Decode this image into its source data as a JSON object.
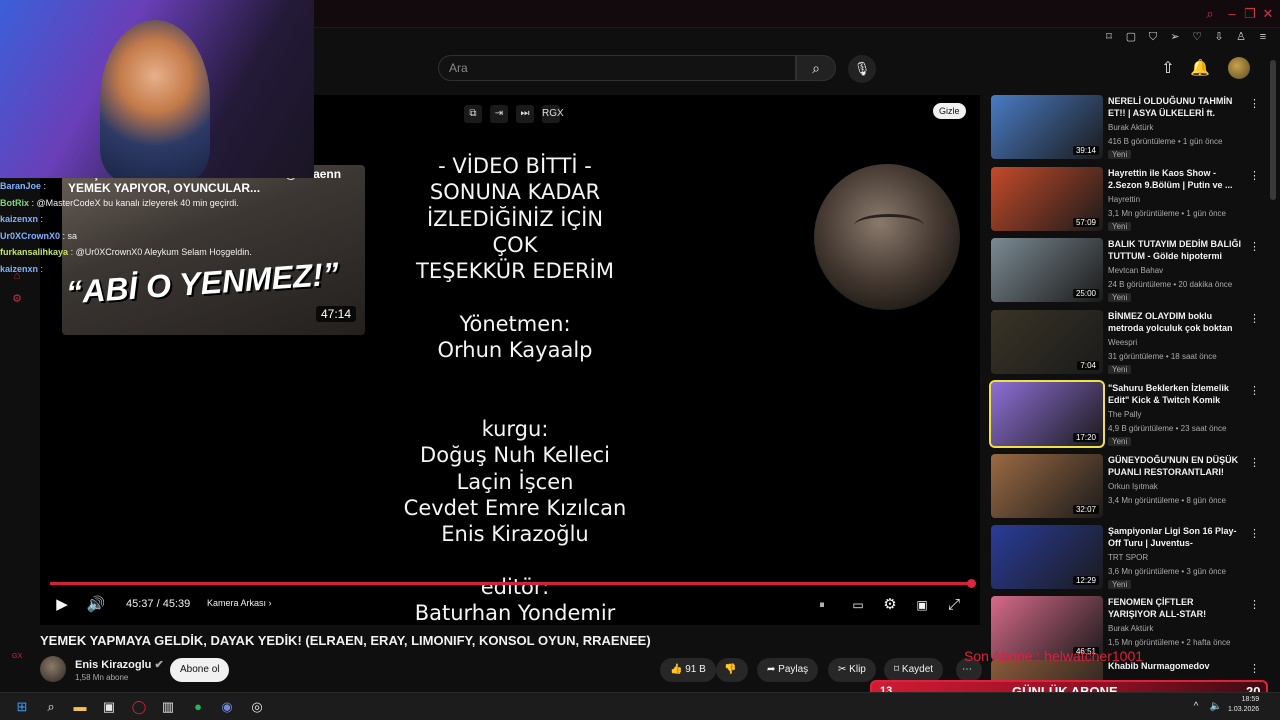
{
  "header": {
    "search_placeholder": "Ara",
    "search_icon": "search-icon",
    "mic_icon": "mic-icon",
    "upload_icon": "upload-icon",
    "bell_icon": "bell-icon"
  },
  "player": {
    "credits": "- VİDEO BİTTİ -\nSONUNA KADAR\nİZLEDİĞİNİZ İÇİN\nÇOK\nTEŞEKKÜR EDERİM\n\nYönetmen:\nOrhun Kayaalp\n\n\nkurgu:\nDoğuş Nuh Kelleci\nLaçin İşcen\nCevdet Emre Kızılcan\nEnis Kirazoğlu\n\neditör:\nBaturhan Yondemir",
    "top_controls": [
      "⧉",
      "⇥",
      "⏭",
      "RGX"
    ],
    "hide_label": "Gizle",
    "time": "45:37 / 45:39",
    "camera_label": "Kamera Arkası",
    "progress": 0.999,
    "pip": {
      "title": "BU İŞ OYUN OYNAMAYA BENZEMEZ! @Elraenn YEMEK YAPIYOR, OYUNCULAR...",
      "big_text": "“ABİ O YENMEZ!”",
      "duration": "47:14"
    }
  },
  "chat": [
    {
      "user": "BaranJoe",
      "text": ":",
      "color": "#7fb2ff"
    },
    {
      "user": "BotRix",
      "text": ": @MasterCodeX bu kanalı izleyerek 40 min geçirdi.",
      "color": "#7bdc7b"
    },
    {
      "user": "kaizenxn",
      "text": ":",
      "color": "#7fb2ff"
    },
    {
      "user": "Ur0XCrownX0",
      "text": ": sa",
      "color": "#7fb2ff"
    },
    {
      "user": "furkansalihkaya",
      "text": ": @Ur0XCrownX0 Aleykum Selam Hoşgeldin.",
      "color": "#c6e36a"
    },
    {
      "user": "kaizenxn",
      "text": ":",
      "color": "#7fb2ff"
    }
  ],
  "video": {
    "title": "YEMEK YAPMAYA GELDİK, DAYAK YEDİK! (ELRAEN, ERAY, LIMONIFY, KONSOL OYUN, RRAENEE)",
    "channel": "Enis Kirazoglu",
    "subscribers": "1,58 Mn abone",
    "subscribe_label": "Abone ol",
    "likes": "91 B",
    "share_label": "Paylaş",
    "clip_label": "Klip",
    "save_label": "Kaydet"
  },
  "recommendations": [
    {
      "title": "NERELİ OLDUĞUNU TAHMİN ET!! | ASYA ÜLKELERİ ft. (Emr...",
      "channel": "Burak Aktürk",
      "meta": "416 B görüntüleme • 1 gün önce",
      "duration": "39:14",
      "new": "Yeni",
      "color": "#4a7bc4"
    },
    {
      "title": "Hayrettin ile Kaos Show - 2.Sezon 9.Bölüm | Putin ve ...",
      "channel": "Hayrettin",
      "meta": "3,1 Mn görüntüleme • 1 gün önce",
      "duration": "57:09",
      "new": "Yeni",
      "color": "#c44a2a"
    },
    {
      "title": "BALIK TUTAYIM DEDİM BALIĞI TUTTUM - Gölde hipotermi keyfi",
      "channel": "Mevtcan Bahav",
      "meta": "24 B görüntüleme • 20 dakika önce",
      "duration": "25:00",
      "new": "Yeni",
      "color": "#7b8a92"
    },
    {
      "title": "BİNMEZ OLAYDIM boklu metroda yolculuk çok boktan b...",
      "channel": "Weespri",
      "meta": "31 görüntüleme • 18 saat önce",
      "duration": "7:04",
      "new": "Yeni",
      "color": "#3a3426"
    },
    {
      "title": "\"Sahuru Beklerken İzlemelik Edit\" Kick & Twitch Komik Anla...",
      "channel": "The Pally",
      "meta": "4,9 B görüntüleme • 23 saat önce",
      "duration": "17:20",
      "new": "Yeni",
      "color": "#8e6fd6"
    },
    {
      "title": "GÜNEYDOĞU'NUN EN DÜŞÜK PUANLI RESTORANTLARI!",
      "channel": "Orkun Işıtmak",
      "meta": "3,4 Mn görüntüleme • 8 gün önce",
      "duration": "32:07",
      "new": "",
      "color": "#9a6a44"
    },
    {
      "title": "Şampiyonlar Ligi Son 16 Play-Off Turu | Juventus-Galatasara...",
      "channel": "TRT SPOR",
      "meta": "3,6 Mn görüntüleme • 3 gün önce",
      "duration": "12:29",
      "new": "Yeni",
      "color": "#2a3c9a"
    },
    {
      "title": "FENOMEN ÇİFTLER YARIŞIYOR ALL-STAR! (SEVGİLİLER GÜNÜ...",
      "channel": "Burak Aktürk",
      "meta": "1,5 Mn görüntüleme • 2 hafta önce",
      "duration": "46:51",
      "new": "",
      "color": "#d76a8a"
    },
    {
      "title": "Khabib Nurmagomedov",
      "channel": "",
      "meta": "",
      "duration": "",
      "new": "",
      "color": "#8a5a3a"
    }
  ],
  "overlay": {
    "sub_ticker": "Son Abone : helwatcher1001",
    "goal_count": "13",
    "goal_label": "GÜNLÜK ABONE",
    "goal_target": "20",
    "left_rail_label": "GX"
  },
  "taskbar": {
    "time": "18:59",
    "date": "1.03.2026"
  },
  "colors": {
    "accent": "#e0203c",
    "background": "#0f0f0f"
  }
}
